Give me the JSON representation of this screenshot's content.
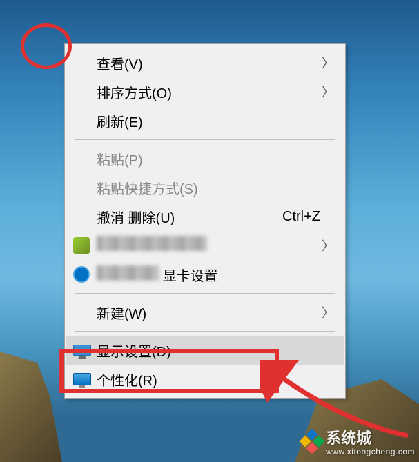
{
  "menu": {
    "view": {
      "label": "查看(V)"
    },
    "sort": {
      "label": "排序方式(O)"
    },
    "refresh": {
      "label": "刷新(E)"
    },
    "paste": {
      "label": "粘贴(P)"
    },
    "paste_shortcut": {
      "label": "粘贴快捷方式(S)"
    },
    "undo_delete": {
      "label": "撤消 删除(U)",
      "shortcut": "Ctrl+Z"
    },
    "gpu_settings_suffix": "显卡设置",
    "new": {
      "label": "新建(W)"
    },
    "display_settings": {
      "label": "显示设置(D)"
    },
    "personalize": {
      "label": "个性化(R)"
    }
  },
  "watermark": {
    "brand": "系统城",
    "url": "www.xitongcheng.com"
  },
  "annotation": {
    "circle_color": "#e03030",
    "box_color": "#e03030",
    "arrow_color": "#e03030"
  }
}
